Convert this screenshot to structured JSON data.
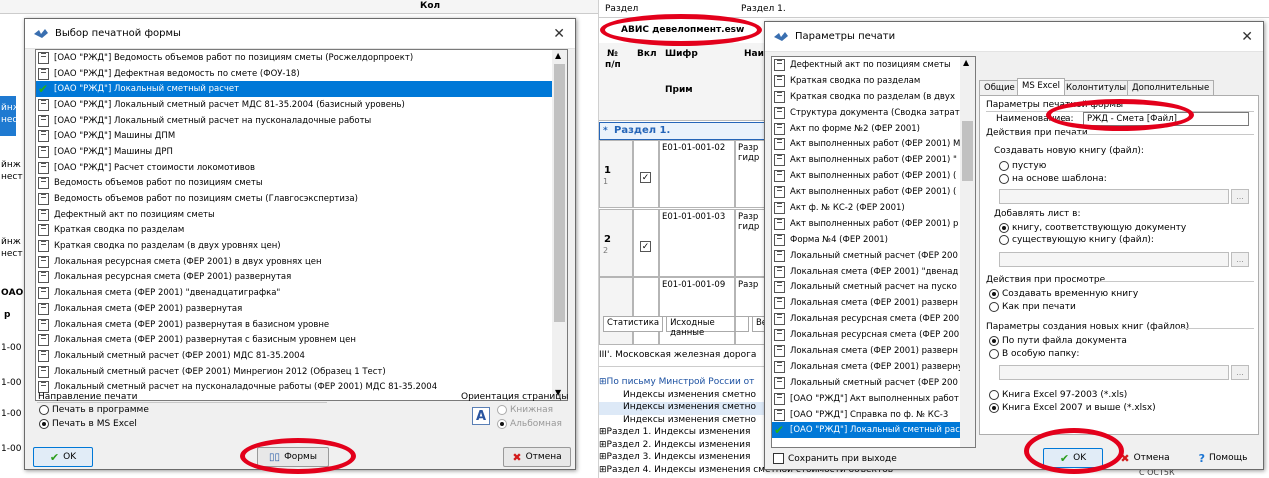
{
  "left_bg": {
    "top_label": "Кол",
    "side_labels": [
      "йнж",
      "нест",
      "йнж",
      "нест",
      "йнж",
      "нест"
    ],
    "code_frag": "ОАО \"",
    "row_frag": "р",
    "nums": [
      "1-00",
      "1-00",
      "1-00",
      "1-00"
    ]
  },
  "left_dialog": {
    "title": "Выбор печатной формы",
    "items": [
      "[ОАО \"РЖД\"] Ведомость объемов работ по позициям сметы (Росжелдорпроект)",
      "[ОАО \"РЖД\"] Дефектная ведомость по смете (ФОУ-18)",
      "[ОАО \"РЖД\"] Локальный сметный расчет",
      "[ОАО \"РЖД\"] Локальный сметный расчет МДС 81-35.2004 (базисный уровень)",
      "[ОАО \"РЖД\"] Локальный сметный расчет на пусконаладочные работы",
      "[ОАО \"РЖД\"] Машины ДПМ",
      "[ОАО \"РЖД\"] Машины ДРП",
      "[ОАО \"РЖД\"] Расчет стоимости локомотивов",
      "Ведомость объемов работ по позициям сметы",
      "Ведомость объемов работ по позициям сметы (Главгосэкспертиза)",
      "Дефектный акт по позициям сметы",
      "Краткая сводка по разделам",
      "Краткая сводка по разделам (в двух уровнях цен)",
      "Локальная ресурсная смета (ФЕР 2001) в двух уровнях цен",
      "Локальная ресурсная смета (ФЕР 2001) развернутая",
      "Локальная смета (ФЕР 2001) \"двенадцатиграфка\"",
      "Локальная смета (ФЕР 2001) развернутая",
      "Локальная смета (ФЕР 2001) развернутая в базисном уровне",
      "Локальная смета (ФЕР 2001) развернутая с базисным уровнем цен",
      "Локальный сметный расчет (ФЕР 2001) МДС 81-35.2004",
      "Локальный сметный расчет (ФЕР 2001) Минрегион 2012 (Образец 1 Тест)",
      "Локальный сметный расчет на пусконаладочные работы (ФЕР 2001) МДС 81-35.2004"
    ],
    "selected_index": 2,
    "direction_title": "Направление печати",
    "direction_opts": [
      "Печать в программе",
      "Печать в MS Excel"
    ],
    "orient_title": "Ориентация страницы",
    "orient_opts": [
      "Книжная",
      "Альбомная"
    ],
    "orient_icon_letter": "A",
    "ok_label": "OK",
    "forms_label": "Формы",
    "cancel_label": "Отмена"
  },
  "right_bg": {
    "col_razdel": "Раздел",
    "razdel_val": "Раздел 1.",
    "company_tab": "АВИС девелопмент.esw",
    "hdr_num": "№",
    "hdr_pp": "п/п",
    "hdr_vkl": "Вкл",
    "hdr_shifr": "Шифр",
    "hdr_nai": "Наи",
    "hdr_prim": "Прим",
    "section_row": "Раздел 1.",
    "rows": [
      {
        "n": "1",
        "sub": "1",
        "code": "Е01-01-001-02",
        "txt": "Разр гидр"
      },
      {
        "n": "2",
        "sub": "2",
        "code": "Е01-01-001-03",
        "txt": "Разр гидр"
      },
      {
        "n": "",
        "sub": "",
        "code": "Е01-01-001-09",
        "txt": "Разр"
      }
    ],
    "bottom_tabs": [
      "Статистика",
      "Исходные данные",
      "Ве"
    ],
    "mosc": "III'. Московская железная дорога",
    "tree": [
      "По письму Минстрой России от",
      "Индексы изменения сметно",
      "Индексы изменения сметно",
      "Индексы изменения сметно",
      "Раздел 1. Индексы изменения",
      "Раздел 2. Индексы изменения",
      "Раздел 3. Индексы изменения",
      "Раздел 4. Индексы изменения сметной стоимости объектов"
    ]
  },
  "right_dialog": {
    "title": "Параметры печати",
    "items": [
      "Дефектный акт по позициям сметы",
      "Краткая сводка по разделам",
      "Краткая сводка по разделам (в двух",
      "Структура документа (Сводка затрат",
      "Акт по форме №2 (ФЕР 2001)",
      "Акт выполненных работ (ФЕР 2001) М",
      "Акт выполненных работ (ФЕР 2001) \"",
      "Акт выполненных работ (ФЕР 2001) (",
      "Акт выполненных работ (ФЕР 2001) (",
      "Акт ф. № КС-2 (ФЕР 2001)",
      "Акт выполненных работ (ФЕР 2001) р",
      "Форма №4 (ФЕР 2001)",
      "Локальный сметный расчет (ФЕР 200",
      "Локальная смета (ФЕР 2001) \"двенад",
      "Локальный сметный расчет на пуско",
      "Локальная смета (ФЕР 2001) разверн",
      "Локальная ресурсная смета (ФЕР 200",
      "Локальная ресурсная смета (ФЕР 200",
      "Локальная смета (ФЕР 2001) разверн",
      "Локальная смета (ФЕР 2001) разверну",
      "Локальный сметный расчет (ФЕР 200",
      "[ОАО \"РЖД\"] Акт выполненных работ",
      "[ОАО \"РЖД\"] Справка по ф. № КС-3",
      "[ОАО \"РЖД\"] Локальный сметный рас"
    ],
    "selected_index": 23,
    "tabs": [
      "Общие",
      "MS Excel",
      "Колонтитулы",
      "Дополнительные"
    ],
    "active_tab": 1,
    "grp_form": "Параметры печатной формы",
    "name_label": "Наименование",
    "name_frag": "а:",
    "name_value": "РЖД - Смета [Файл]",
    "grp_print": "Действия при печати",
    "create_label": "Создавать новую книгу (файл):",
    "create_opts": [
      "пустую",
      "на основе шаблона:"
    ],
    "add_label": "Добавлять лист в:",
    "add_opts": [
      "книгу, соответствующую документу",
      "существующую книгу (файл):"
    ],
    "grp_view": "Действия при просмотре",
    "view_opts": [
      "Создавать временную книгу",
      "Как при печати"
    ],
    "grp_new": "Параметры создания новых книг (файлов)",
    "new_opts": [
      "По пути файла документа",
      "В особую папку:"
    ],
    "ver_opts": [
      "Книга Excel 97-2003 (*.xls)",
      "Книга Excel 2007 и выше (*.xlsx)"
    ],
    "ellipsis": "...",
    "save_label": "Сохранить при выходе",
    "ok_label": "OK",
    "cancel_label": "Отмена",
    "help_label": "Помощь",
    "right_bg_frag": "С ОСТ5К"
  }
}
